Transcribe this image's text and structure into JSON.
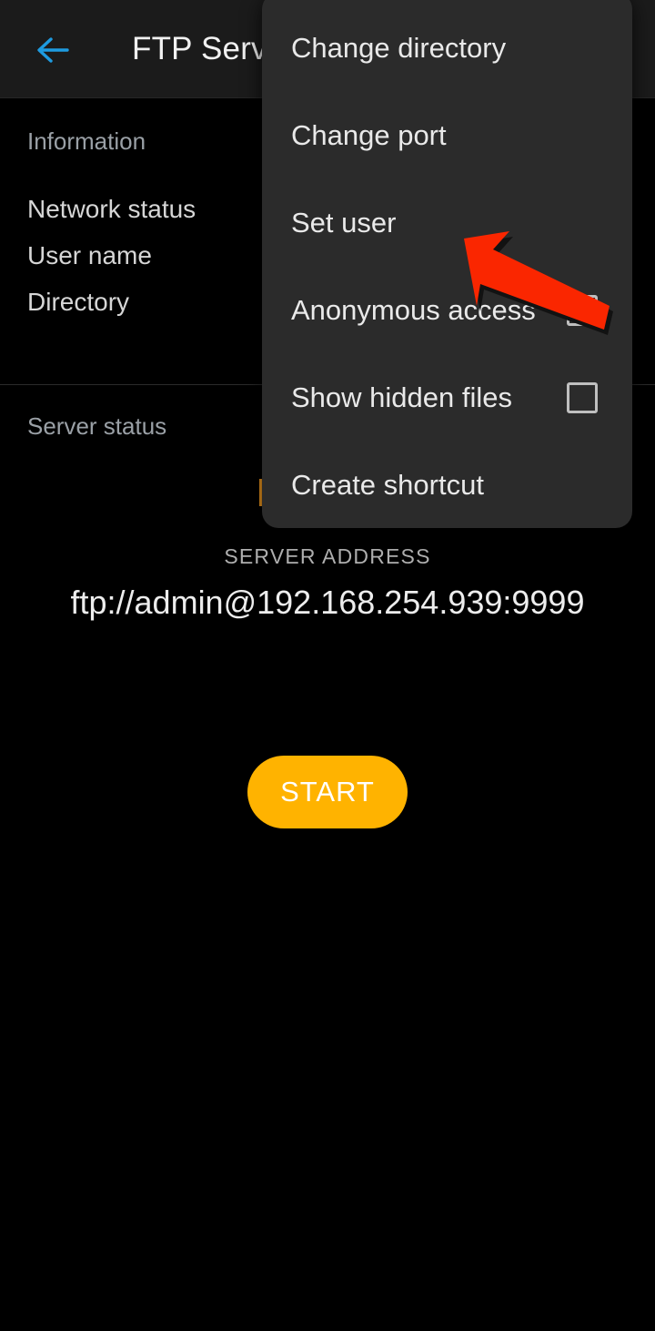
{
  "appbar": {
    "back_icon": "back-arrow-icon",
    "back_icon_color": "#1E9BE0",
    "title": "FTP Serve"
  },
  "info_panel": {
    "section_title": "Information",
    "rows": [
      {
        "label": "Network status"
      },
      {
        "label": "User name"
      },
      {
        "label": "Directory"
      }
    ],
    "server_section_title": "Server status",
    "server_status_accent_color": "#F29A1F"
  },
  "server_address": {
    "label": "SERVER ADDRESS",
    "value": "ftp://admin@192.168.254.939:9999"
  },
  "start_button": {
    "label": "START",
    "color": "#FFB300",
    "text_color": "#FFFFFF"
  },
  "menu": {
    "background": "#2B2B2B",
    "items": [
      {
        "label": "Change directory",
        "has_checkbox": false,
        "checked": false
      },
      {
        "label": "Change port",
        "has_checkbox": false,
        "checked": false
      },
      {
        "label": "Set user",
        "has_checkbox": false,
        "checked": false
      },
      {
        "label": "Anonymous access",
        "has_checkbox": true,
        "checked": false
      },
      {
        "label": "Show hidden files",
        "has_checkbox": true,
        "checked": false
      },
      {
        "label": "Create shortcut",
        "has_checkbox": false,
        "checked": false
      }
    ]
  },
  "annotation": {
    "icon": "red-arrow-pointer-icon",
    "color": "#FA2600",
    "points_at": "Set user"
  }
}
